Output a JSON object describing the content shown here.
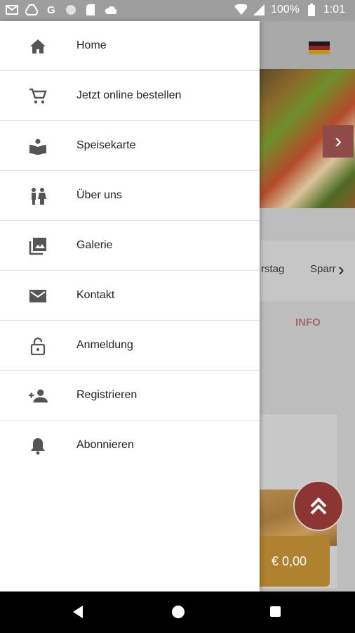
{
  "status_bar": {
    "notification_icons": [
      "gmail-icon",
      "drive-icon",
      "google-icon",
      "circle-icon",
      "sim-icon",
      "cloud-icon"
    ],
    "battery": "100%",
    "time": "1:01"
  },
  "background_app": {
    "carousel_chips": [
      "rstag",
      "Sparr"
    ],
    "info_tab": "INFO",
    "price": "€ 0,00",
    "accent_color": "#b71c1c"
  },
  "drawer": {
    "items": [
      {
        "label": "Home",
        "icon": "home-icon"
      },
      {
        "label": "Jetzt online bestellen",
        "icon": "cart-icon"
      },
      {
        "label": "Speisekarte",
        "icon": "menu-book-icon"
      },
      {
        "label": "Über uns",
        "icon": "people-icon"
      },
      {
        "label": "Galerie",
        "icon": "gallery-icon"
      },
      {
        "label": "Kontakt",
        "icon": "mail-icon"
      },
      {
        "label": "Anmeldung",
        "icon": "lock-open-icon"
      },
      {
        "label": "Registrieren",
        "icon": "person-add-icon"
      },
      {
        "label": "Abonnieren",
        "icon": "bell-icon"
      }
    ]
  }
}
